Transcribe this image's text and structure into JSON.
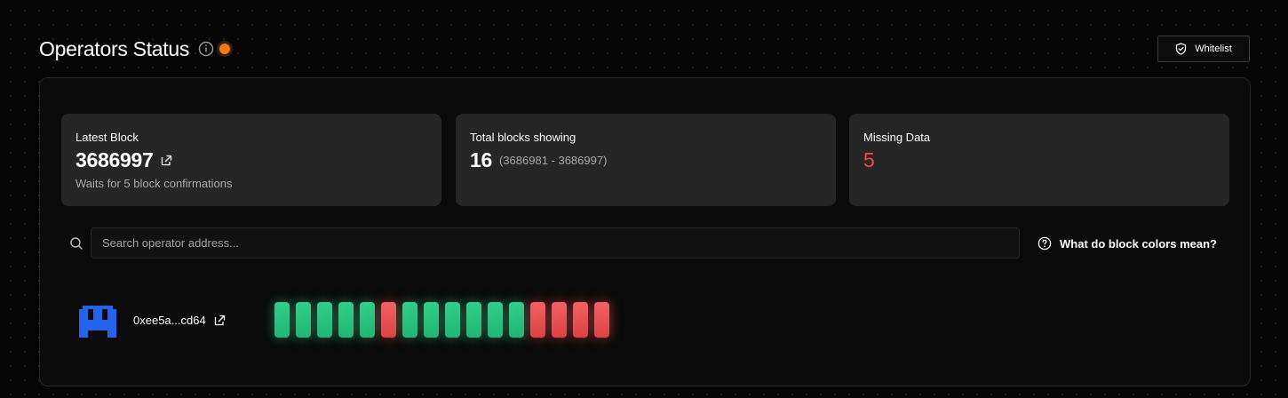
{
  "header": {
    "title": "Operators Status",
    "info_icon": "info-circle-icon",
    "status_color": "#f27a1a"
  },
  "whitelist": {
    "label": "Whitelist",
    "icon": "shield-check-icon"
  },
  "cards": {
    "latest_block": {
      "label": "Latest Block",
      "value": "3686997",
      "note": "Waits for 5 block confirmations",
      "icon": "external-link-icon"
    },
    "total_blocks": {
      "label": "Total blocks showing",
      "value": "16",
      "range": "(3686981 - 3686997)"
    },
    "missing_data": {
      "label": "Missing Data",
      "value": "5",
      "value_color": "#ee4b4b"
    }
  },
  "search": {
    "placeholder": "Search operator address...",
    "value": "",
    "icon": "search-icon"
  },
  "help": {
    "label": "What do block colors mean?",
    "icon": "question-circle-icon"
  },
  "operators": [
    {
      "address": "0xee5a...cd64",
      "avatar": "pixel-avatar",
      "blocks": [
        "ok",
        "ok",
        "ok",
        "ok",
        "ok",
        "missing",
        "ok",
        "ok",
        "ok",
        "ok",
        "ok",
        "ok",
        "missing",
        "missing",
        "missing",
        "missing"
      ]
    }
  ],
  "colors": {
    "ok": "#22c17a",
    "missing": "#ef4444",
    "accent": "#f27a1a"
  }
}
